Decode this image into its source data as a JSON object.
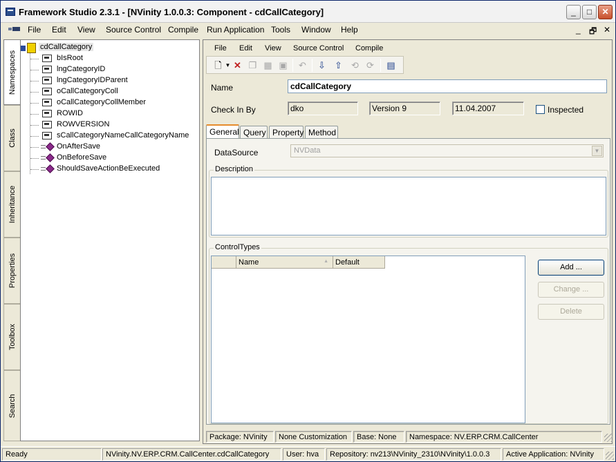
{
  "window": {
    "title": "Framework Studio 2.3.1 - [NVinity 1.0.0.3: Component - cdCallCategory]"
  },
  "title_controls": {
    "minimize": "_",
    "maximize": "□",
    "close": "✕"
  },
  "menubar": {
    "items": [
      "File",
      "Edit",
      "View",
      "Source Control",
      "Compile",
      "Run Application",
      "Tools",
      "Window",
      "Help"
    ],
    "mdi_controls": {
      "minimize": "_",
      "restore": "🗗",
      "close": "✕"
    }
  },
  "sidetabs": [
    "Namespaces",
    "Class",
    "Inheritance",
    "Properties",
    "Toolbox",
    "Search"
  ],
  "tree": {
    "root": "cdCallCategory",
    "properties": [
      "bIsRoot",
      "lngCategoryID",
      "lngCategoryIDParent",
      "oCallCategoryColl",
      "oCallCategoryCollMember",
      "ROWID",
      "ROWVERSION",
      "sCallCategoryNameCallCategoryName"
    ],
    "methods": [
      "OnAfterSave",
      "OnBeforeSave",
      "ShouldSaveActionBeExecuted"
    ]
  },
  "submenu": [
    "File",
    "Edit",
    "View",
    "Source Control",
    "Compile"
  ],
  "form": {
    "name_label": "Name",
    "name_value": "cdCallCategory",
    "checkin_label": "Check In By",
    "checkin_user": "dko",
    "checkin_version": "Version 9",
    "checkin_date": "11.04.2007",
    "inspected_label": "Inspected"
  },
  "tabs": [
    "General",
    "Query",
    "Property",
    "Method"
  ],
  "general": {
    "datasource_label": "DataSource",
    "datasource_value": "NVData",
    "description_title": "Description",
    "controltypes_title": "ControlTypes",
    "grid_headers": [
      "Name",
      "Default"
    ],
    "buttons": {
      "add": "Add ...",
      "change": "Change ...",
      "delete": "Delete"
    }
  },
  "infobar": {
    "package": "Package: NVinity",
    "customization": "None Customization",
    "base": "Base: None",
    "namespace": "Namespace: NV.ERP.CRM.CallCenter"
  },
  "statusbar": {
    "ready": "Ready",
    "component": "NVinity.NV.ERP.CRM.CallCenter.cdCallCategory",
    "user": "User: hva",
    "repository": "Repository: nv213\\NVinity_2310\\NVinity\\1.0.0.3",
    "active": "Active Application: NVinity"
  }
}
